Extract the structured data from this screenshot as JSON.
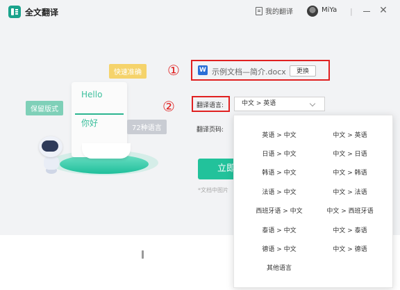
{
  "window": {
    "title": "全文翻译",
    "my_translations": "我的翻译",
    "username": "MiYa",
    "separator": "|",
    "close_glyph": "✕"
  },
  "illustration": {
    "tag_fast": "快速准确",
    "tag_keep_format": "保留版式",
    "tag_langs": "72种语言",
    "paper_en": "Hello",
    "paper_zh": "你好"
  },
  "markers": {
    "one": "①",
    "two": "②"
  },
  "file": {
    "icon_letter": "W",
    "name": "示例文档—简介.docx",
    "change_button": "更换"
  },
  "settings": {
    "language_label": "翻译语言:",
    "language_value": "中文 > 英语",
    "pages_label": "翻译页码:",
    "start_button": "立即",
    "hint": "*文档中图片"
  },
  "dropdown": {
    "left": [
      "英语 > 中文",
      "日语 > 中文",
      "韩语 > 中文",
      "法语 > 中文",
      "西班牙语 > 中文",
      "泰语 > 中文",
      "德语 > 中文"
    ],
    "right": [
      "中文 > 英语",
      "中文 > 日语",
      "中文 > 韩语",
      "中文 > 法语",
      "中文 > 西班牙语",
      "中文 > 泰语",
      "中文 > 德语"
    ],
    "other": "其他语言"
  },
  "colors": {
    "accent": "#22c29b",
    "highlight_border": "#e02020",
    "word_blue": "#2b6fd6"
  },
  "icons": {
    "app": "app-logo-icon",
    "my_translations": "document-icon",
    "word": "word-file-icon",
    "dropdown": "chevron-down-icon"
  }
}
